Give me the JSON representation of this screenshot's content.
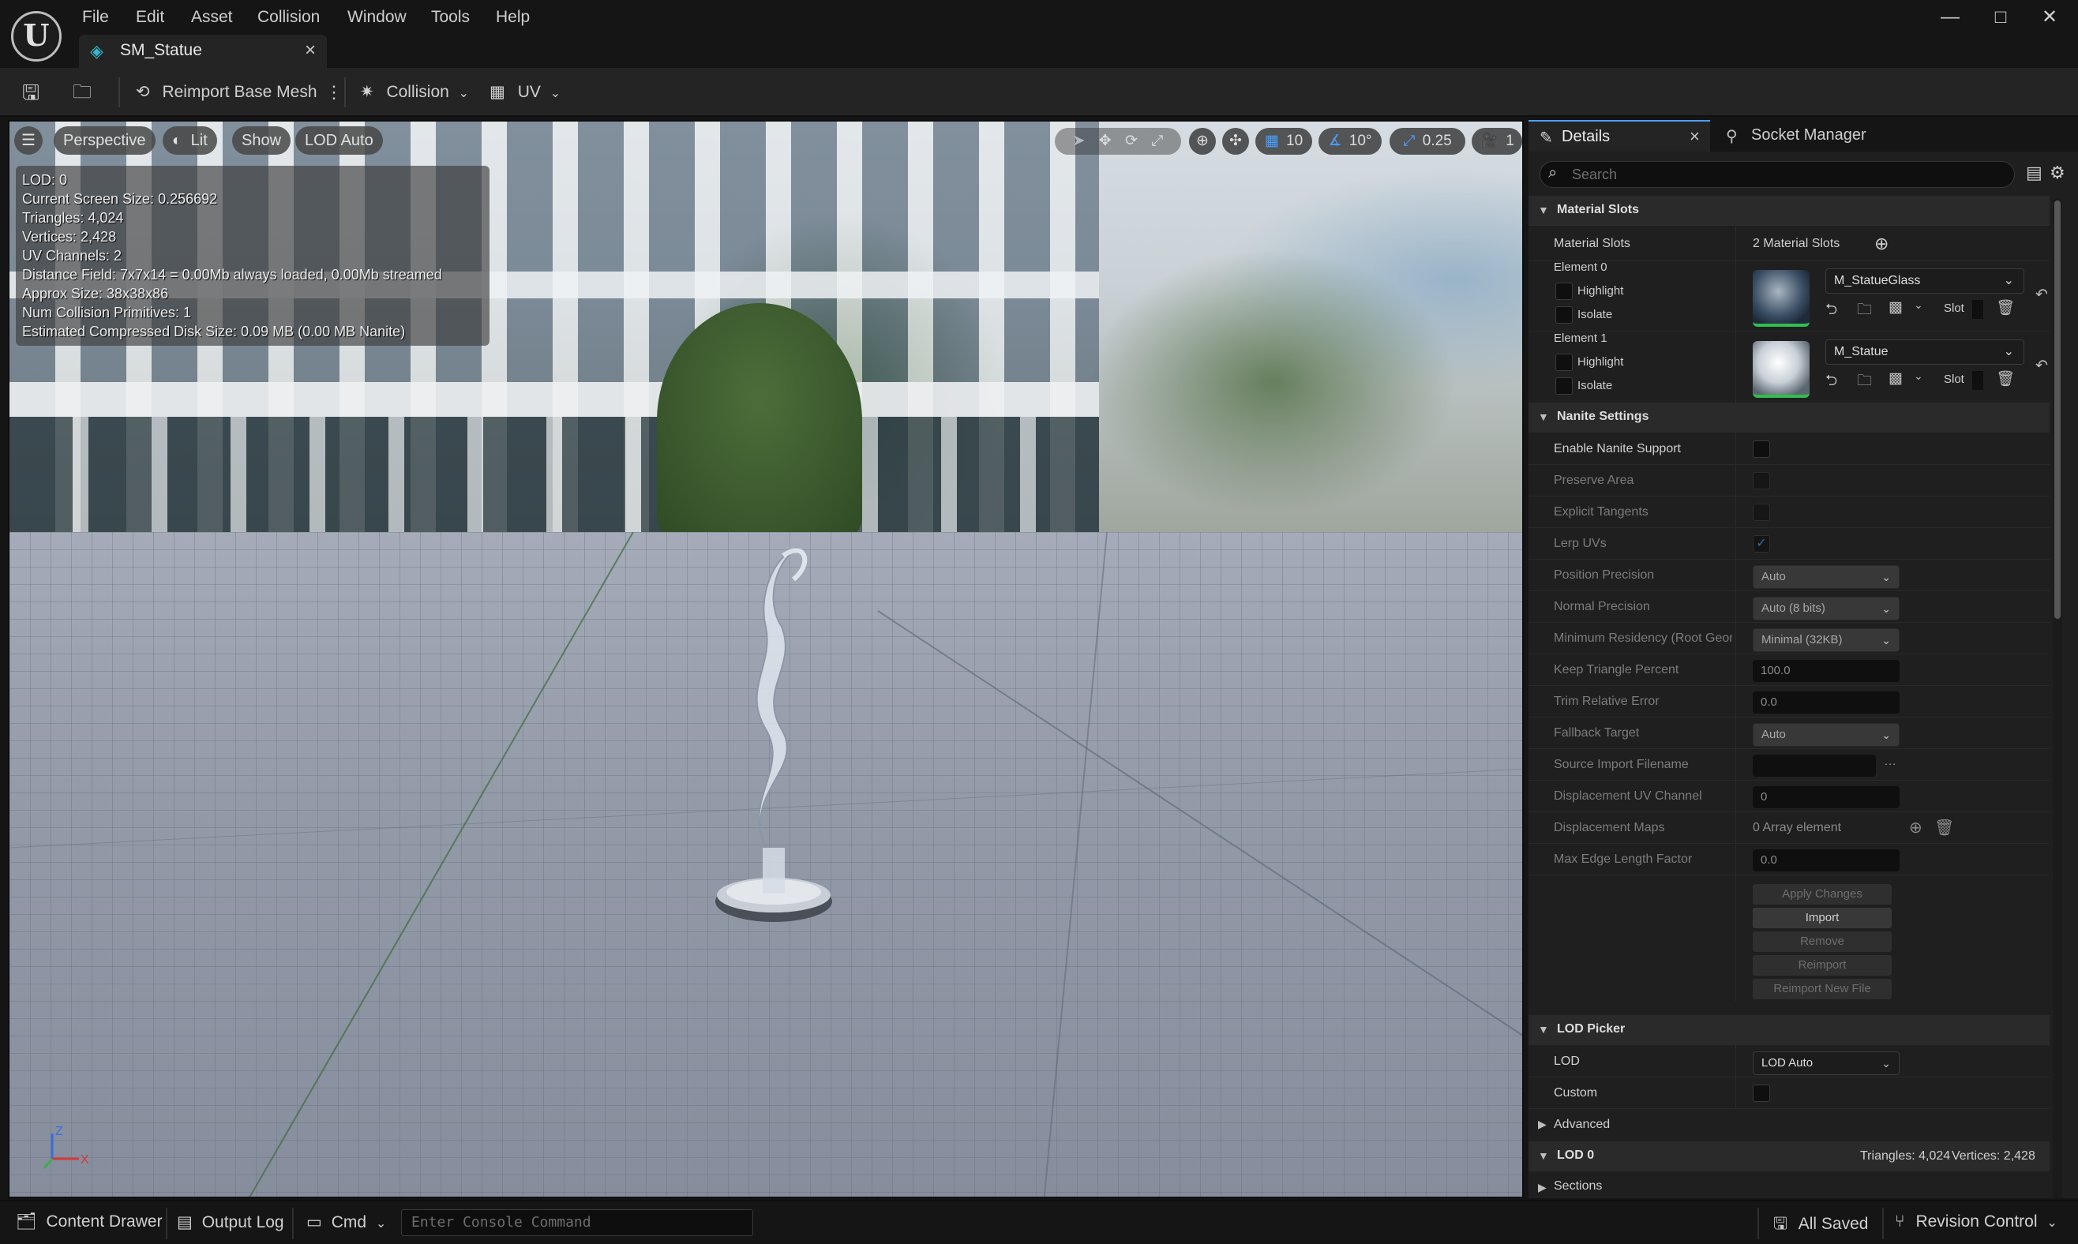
{
  "app": {
    "logo_letter": "U"
  },
  "menu": [
    "File",
    "Edit",
    "Asset",
    "Collision",
    "Window",
    "Tools",
    "Help"
  ],
  "tab": {
    "title": "SM_Statue",
    "close": "×"
  },
  "window_buttons": {
    "minimize": "—",
    "maximize": "□",
    "close": "✕"
  },
  "toolbar": {
    "reimport": "Reimport Base Mesh",
    "collision": "Collision",
    "uv": "UV"
  },
  "viewport": {
    "perspective": "Perspective",
    "lit": "Lit",
    "show": "Show",
    "lod": "LOD Auto",
    "grid_snap": "10",
    "rotation_snap": "10°",
    "scale_snap": "0.25",
    "camera_speed": "1",
    "stats": [
      "LOD:  0",
      "Current Screen Size:  0.256692",
      "Triangles:  4,024",
      "Vertices:  2,428",
      "UV Channels:  2",
      "Distance Field:  7x7x14 = 0.00Mb always loaded, 0.00Mb streamed",
      "Approx Size: 38x38x86",
      "Num Collision Primitives:  1",
      "Estimated Compressed Disk Size: 0.09 MB (0.00 MB Nanite)"
    ],
    "axis": {
      "z": "Z",
      "x": "X"
    }
  },
  "details": {
    "tab_label": "Details",
    "tab_close": "×",
    "socket_tab": "Socket Manager",
    "search_placeholder": "Search",
    "material_slots": {
      "header": "Material Slots",
      "label": "Material Slots",
      "value": "2 Material Slots",
      "elements": [
        {
          "label": "Element 0",
          "highlight": "Highlight",
          "isolate": "Isolate",
          "material": "M_StatueGlass",
          "slot": "Slot"
        },
        {
          "label": "Element 1",
          "highlight": "Highlight",
          "isolate": "Isolate",
          "material": "M_Statue",
          "slot": "Slot"
        }
      ]
    },
    "nanite": {
      "header": "Nanite Settings",
      "enable": "Enable Nanite Support",
      "preserve_area": "Preserve Area",
      "explicit_tangents": "Explicit Tangents",
      "lerp_uvs": "Lerp UVs",
      "position_precision": {
        "label": "Position Precision",
        "value": "Auto"
      },
      "normal_precision": {
        "label": "Normal Precision",
        "value": "Auto (8 bits)"
      },
      "min_residency": {
        "label": "Minimum Residency (Root Geom",
        "value": "Minimal (32KB)"
      },
      "keep_triangle": {
        "label": "Keep Triangle Percent",
        "value": "100.0"
      },
      "trim_error": {
        "label": "Trim Relative Error",
        "value": "0.0"
      },
      "fallback": {
        "label": "Fallback Target",
        "value": "Auto"
      },
      "source_import": {
        "label": "Source Import Filename",
        "value": ""
      },
      "disp_uv": {
        "label": "Displacement UV Channel",
        "value": "0"
      },
      "disp_maps": {
        "label": "Displacement Maps",
        "value": "0 Array element"
      },
      "max_edge": {
        "label": "Max Edge Length Factor",
        "value": "0.0"
      },
      "buttons": [
        "Apply Changes",
        "Import",
        "Remove",
        "Reimport",
        "Reimport New File"
      ]
    },
    "lod_picker": {
      "header": "LOD Picker",
      "lod_label": "LOD",
      "lod_value": "LOD Auto",
      "custom": "Custom",
      "advanced": "Advanced"
    },
    "lod0": {
      "header": "LOD 0",
      "triangles": "Triangles: 4,024",
      "vertices": "Vertices: 2,428",
      "sections": "Sections"
    }
  },
  "statusbar": {
    "content_drawer": "Content Drawer",
    "output_log": "Output Log",
    "cmd": "Cmd",
    "console_placeholder": "Enter Console Command",
    "saved": "All Saved",
    "revision": "Revision Control"
  }
}
